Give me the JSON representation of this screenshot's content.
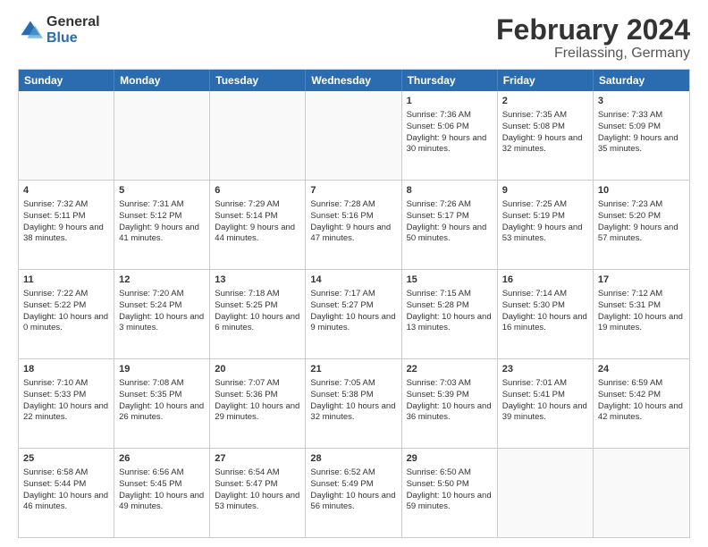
{
  "logo": {
    "general": "General",
    "blue": "Blue"
  },
  "title": "February 2024",
  "subtitle": "Freilassing, Germany",
  "header_days": [
    "Sunday",
    "Monday",
    "Tuesday",
    "Wednesday",
    "Thursday",
    "Friday",
    "Saturday"
  ],
  "weeks": [
    [
      {
        "day": "",
        "sunrise": "",
        "sunset": "",
        "daylight": "",
        "empty": true
      },
      {
        "day": "",
        "sunrise": "",
        "sunset": "",
        "daylight": "",
        "empty": true
      },
      {
        "day": "",
        "sunrise": "",
        "sunset": "",
        "daylight": "",
        "empty": true
      },
      {
        "day": "",
        "sunrise": "",
        "sunset": "",
        "daylight": "",
        "empty": true
      },
      {
        "day": "1",
        "sunrise": "Sunrise: 7:36 AM",
        "sunset": "Sunset: 5:06 PM",
        "daylight": "Daylight: 9 hours and 30 minutes.",
        "empty": false
      },
      {
        "day": "2",
        "sunrise": "Sunrise: 7:35 AM",
        "sunset": "Sunset: 5:08 PM",
        "daylight": "Daylight: 9 hours and 32 minutes.",
        "empty": false
      },
      {
        "day": "3",
        "sunrise": "Sunrise: 7:33 AM",
        "sunset": "Sunset: 5:09 PM",
        "daylight": "Daylight: 9 hours and 35 minutes.",
        "empty": false
      }
    ],
    [
      {
        "day": "4",
        "sunrise": "Sunrise: 7:32 AM",
        "sunset": "Sunset: 5:11 PM",
        "daylight": "Daylight: 9 hours and 38 minutes.",
        "empty": false
      },
      {
        "day": "5",
        "sunrise": "Sunrise: 7:31 AM",
        "sunset": "Sunset: 5:12 PM",
        "daylight": "Daylight: 9 hours and 41 minutes.",
        "empty": false
      },
      {
        "day": "6",
        "sunrise": "Sunrise: 7:29 AM",
        "sunset": "Sunset: 5:14 PM",
        "daylight": "Daylight: 9 hours and 44 minutes.",
        "empty": false
      },
      {
        "day": "7",
        "sunrise": "Sunrise: 7:28 AM",
        "sunset": "Sunset: 5:16 PM",
        "daylight": "Daylight: 9 hours and 47 minutes.",
        "empty": false
      },
      {
        "day": "8",
        "sunrise": "Sunrise: 7:26 AM",
        "sunset": "Sunset: 5:17 PM",
        "daylight": "Daylight: 9 hours and 50 minutes.",
        "empty": false
      },
      {
        "day": "9",
        "sunrise": "Sunrise: 7:25 AM",
        "sunset": "Sunset: 5:19 PM",
        "daylight": "Daylight: 9 hours and 53 minutes.",
        "empty": false
      },
      {
        "day": "10",
        "sunrise": "Sunrise: 7:23 AM",
        "sunset": "Sunset: 5:20 PM",
        "daylight": "Daylight: 9 hours and 57 minutes.",
        "empty": false
      }
    ],
    [
      {
        "day": "11",
        "sunrise": "Sunrise: 7:22 AM",
        "sunset": "Sunset: 5:22 PM",
        "daylight": "Daylight: 10 hours and 0 minutes.",
        "empty": false
      },
      {
        "day": "12",
        "sunrise": "Sunrise: 7:20 AM",
        "sunset": "Sunset: 5:24 PM",
        "daylight": "Daylight: 10 hours and 3 minutes.",
        "empty": false
      },
      {
        "day": "13",
        "sunrise": "Sunrise: 7:18 AM",
        "sunset": "Sunset: 5:25 PM",
        "daylight": "Daylight: 10 hours and 6 minutes.",
        "empty": false
      },
      {
        "day": "14",
        "sunrise": "Sunrise: 7:17 AM",
        "sunset": "Sunset: 5:27 PM",
        "daylight": "Daylight: 10 hours and 9 minutes.",
        "empty": false
      },
      {
        "day": "15",
        "sunrise": "Sunrise: 7:15 AM",
        "sunset": "Sunset: 5:28 PM",
        "daylight": "Daylight: 10 hours and 13 minutes.",
        "empty": false
      },
      {
        "day": "16",
        "sunrise": "Sunrise: 7:14 AM",
        "sunset": "Sunset: 5:30 PM",
        "daylight": "Daylight: 10 hours and 16 minutes.",
        "empty": false
      },
      {
        "day": "17",
        "sunrise": "Sunrise: 7:12 AM",
        "sunset": "Sunset: 5:31 PM",
        "daylight": "Daylight: 10 hours and 19 minutes.",
        "empty": false
      }
    ],
    [
      {
        "day": "18",
        "sunrise": "Sunrise: 7:10 AM",
        "sunset": "Sunset: 5:33 PM",
        "daylight": "Daylight: 10 hours and 22 minutes.",
        "empty": false
      },
      {
        "day": "19",
        "sunrise": "Sunrise: 7:08 AM",
        "sunset": "Sunset: 5:35 PM",
        "daylight": "Daylight: 10 hours and 26 minutes.",
        "empty": false
      },
      {
        "day": "20",
        "sunrise": "Sunrise: 7:07 AM",
        "sunset": "Sunset: 5:36 PM",
        "daylight": "Daylight: 10 hours and 29 minutes.",
        "empty": false
      },
      {
        "day": "21",
        "sunrise": "Sunrise: 7:05 AM",
        "sunset": "Sunset: 5:38 PM",
        "daylight": "Daylight: 10 hours and 32 minutes.",
        "empty": false
      },
      {
        "day": "22",
        "sunrise": "Sunrise: 7:03 AM",
        "sunset": "Sunset: 5:39 PM",
        "daylight": "Daylight: 10 hours and 36 minutes.",
        "empty": false
      },
      {
        "day": "23",
        "sunrise": "Sunrise: 7:01 AM",
        "sunset": "Sunset: 5:41 PM",
        "daylight": "Daylight: 10 hours and 39 minutes.",
        "empty": false
      },
      {
        "day": "24",
        "sunrise": "Sunrise: 6:59 AM",
        "sunset": "Sunset: 5:42 PM",
        "daylight": "Daylight: 10 hours and 42 minutes.",
        "empty": false
      }
    ],
    [
      {
        "day": "25",
        "sunrise": "Sunrise: 6:58 AM",
        "sunset": "Sunset: 5:44 PM",
        "daylight": "Daylight: 10 hours and 46 minutes.",
        "empty": false
      },
      {
        "day": "26",
        "sunrise": "Sunrise: 6:56 AM",
        "sunset": "Sunset: 5:45 PM",
        "daylight": "Daylight: 10 hours and 49 minutes.",
        "empty": false
      },
      {
        "day": "27",
        "sunrise": "Sunrise: 6:54 AM",
        "sunset": "Sunset: 5:47 PM",
        "daylight": "Daylight: 10 hours and 53 minutes.",
        "empty": false
      },
      {
        "day": "28",
        "sunrise": "Sunrise: 6:52 AM",
        "sunset": "Sunset: 5:49 PM",
        "daylight": "Daylight: 10 hours and 56 minutes.",
        "empty": false
      },
      {
        "day": "29",
        "sunrise": "Sunrise: 6:50 AM",
        "sunset": "Sunset: 5:50 PM",
        "daylight": "Daylight: 10 hours and 59 minutes.",
        "empty": false
      },
      {
        "day": "",
        "sunrise": "",
        "sunset": "",
        "daylight": "",
        "empty": true
      },
      {
        "day": "",
        "sunrise": "",
        "sunset": "",
        "daylight": "",
        "empty": true
      }
    ]
  ]
}
